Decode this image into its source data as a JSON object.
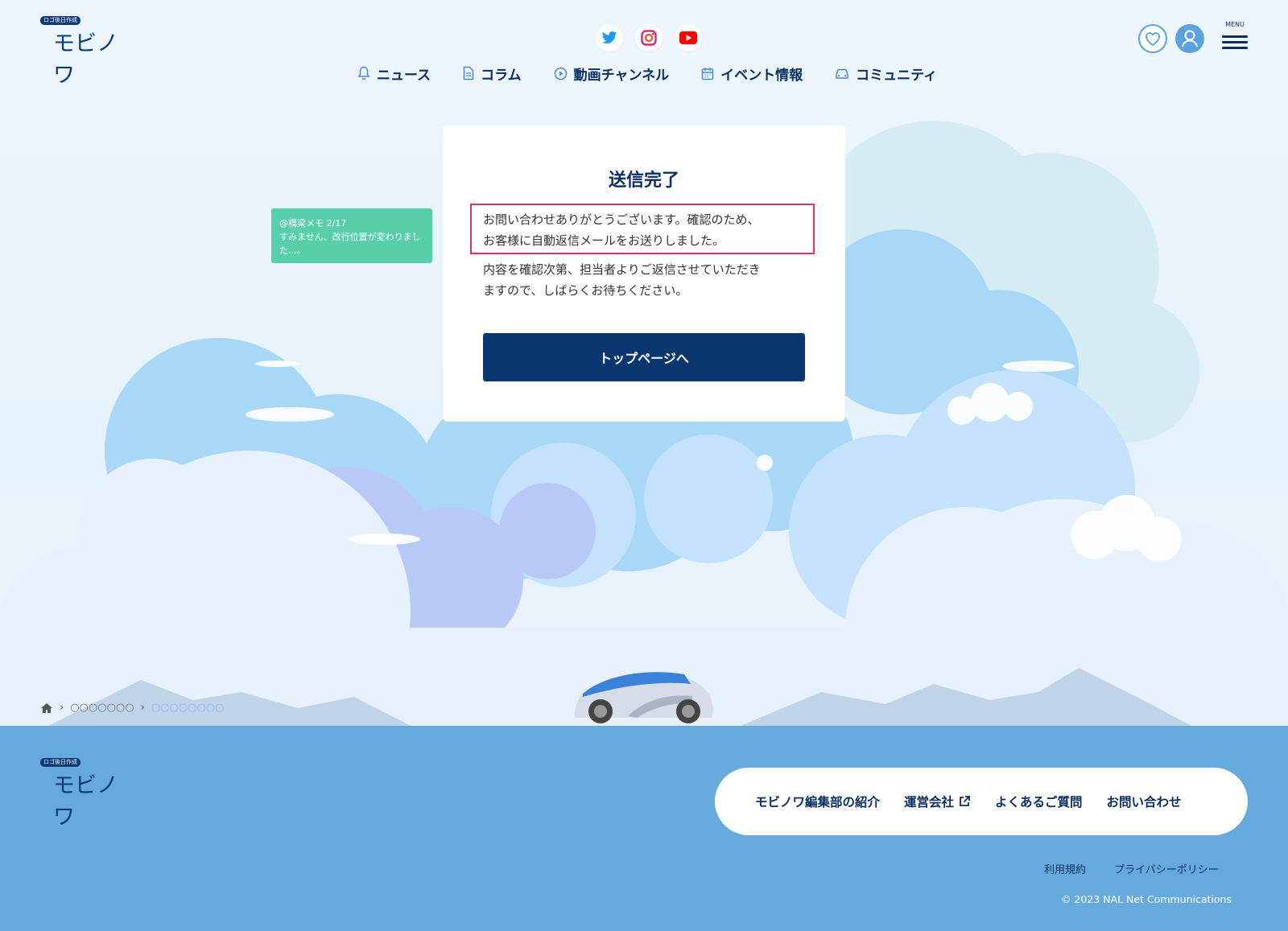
{
  "header": {
    "logo": {
      "tag": "ロゴ後日作成",
      "name": "モビノワ"
    },
    "social": [
      {
        "icon": "twitter-icon",
        "color": "#1d9bf0"
      },
      {
        "icon": "instagram-icon",
        "color": "#e1306c"
      },
      {
        "icon": "youtube-icon",
        "color": "#ff0000"
      }
    ],
    "nav": [
      {
        "label": "ニュース",
        "icon": "bell-icon"
      },
      {
        "label": "コラム",
        "icon": "document-icon"
      },
      {
        "label": "動画チャンネル",
        "icon": "play-icon"
      },
      {
        "label": "イベント情報",
        "icon": "calendar-icon"
      },
      {
        "label": "コミュニティ",
        "icon": "car-icon"
      }
    ],
    "menu_label": "MENU"
  },
  "card": {
    "title": "送信完了",
    "message_lines": [
      "お問い合わせありがとうございます。確認のため、",
      "お客様に自動返信メールをお送りしました。",
      "内容を確認次第、担当者よりご返信させていただき",
      "ますので、しばらくお待ちください。"
    ],
    "button_label": "トップページへ"
  },
  "note": {
    "author": "@橋梁メモ 2/17",
    "text": "すみません、改行位置が変わりました…。"
  },
  "breadcrumb": {
    "items": [
      "○○○○○○○",
      "○○○○○○○○"
    ]
  },
  "footer": {
    "logo": {
      "tag": "ロゴ後日作成",
      "name": "モビノワ"
    },
    "links": [
      "モビノワ編集部の紹介",
      "運営会社",
      "よくあるご質問",
      "お問い合わせ"
    ],
    "legal": [
      "利用規約",
      "プライバシーポリシー"
    ],
    "copyright": "© 2023 NAL Net Communications"
  },
  "colors": {
    "brand_navy": "#0b3770",
    "footer_blue": "#66aadd",
    "note_green": "#57cfa9",
    "highlight": "#d8336e"
  }
}
